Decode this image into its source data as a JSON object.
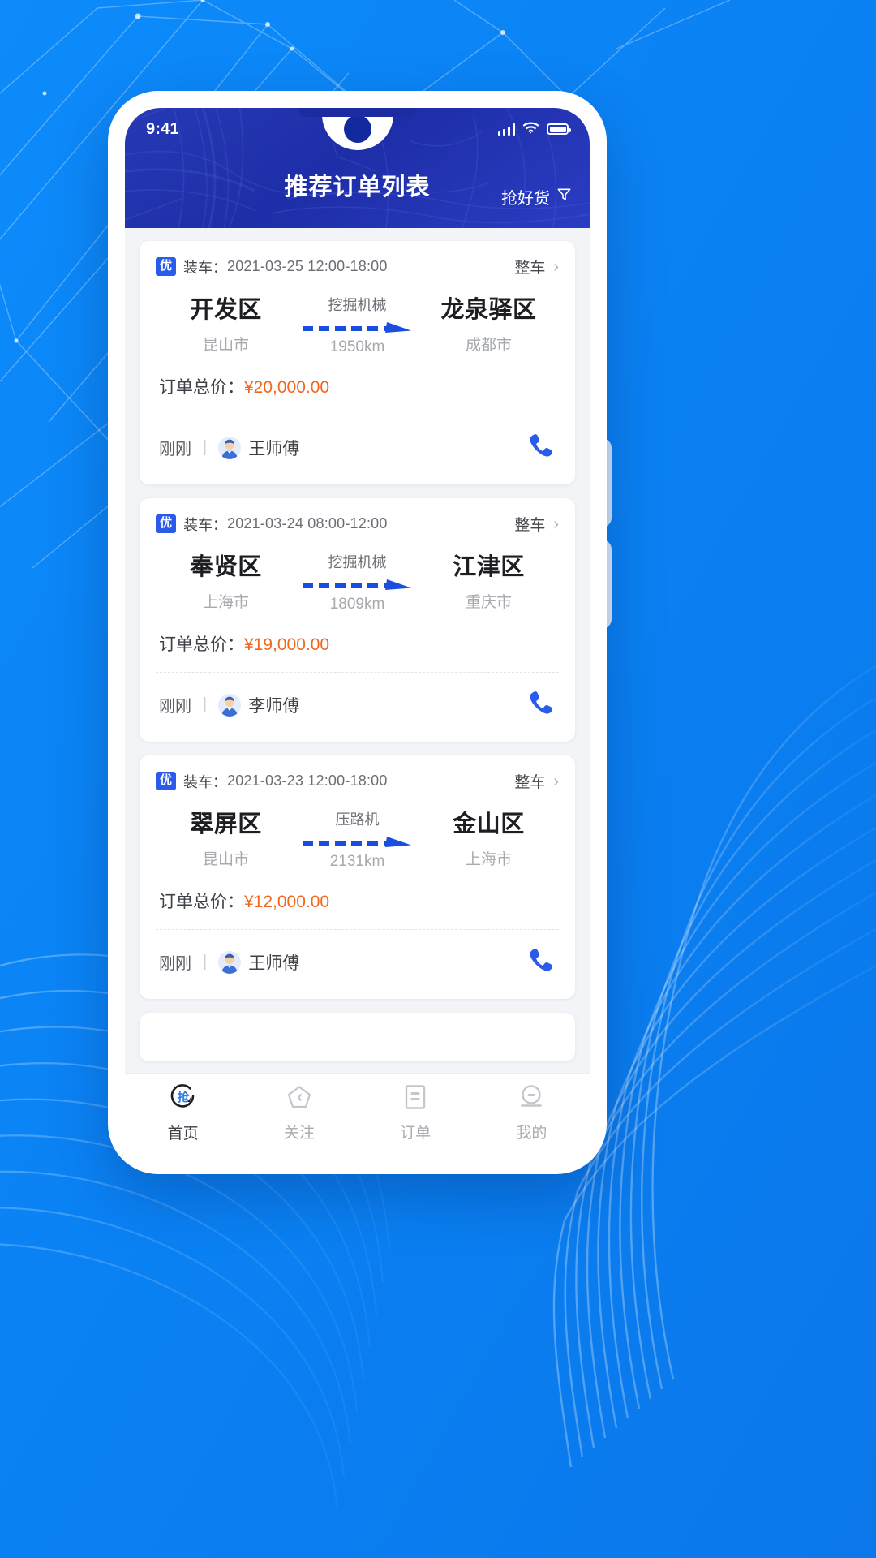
{
  "status_bar": {
    "time": "9:41",
    "signal_icon": "signal-bars-icon",
    "wifi_icon": "wifi-icon",
    "battery_icon": "battery-icon"
  },
  "header": {
    "title": "推荐订单列表",
    "action_label": "抢好货",
    "action_icon": "filter-funnel-icon"
  },
  "orders": [
    {
      "badge": "优",
      "load_label": "装车：",
      "load_time": "2021-03-25 12:00-18:00",
      "type_label": "整车",
      "chevron": "›",
      "from_district": "开发区",
      "from_city": "昆山市",
      "cargo": "挖掘机械",
      "distance": "1950km",
      "to_district": "龙泉驿区",
      "to_city": "成都市",
      "price_label": "订单总价：",
      "price_value": "¥20,000.00",
      "posted_time": "刚刚",
      "separator": "|",
      "driver": "王师傅",
      "call_icon": "phone-icon"
    },
    {
      "badge": "优",
      "load_label": "装车：",
      "load_time": "2021-03-24 08:00-12:00",
      "type_label": "整车",
      "chevron": "›",
      "from_district": "奉贤区",
      "from_city": "上海市",
      "cargo": "挖掘机械",
      "distance": "1809km",
      "to_district": "江津区",
      "to_city": "重庆市",
      "price_label": "订单总价：",
      "price_value": "¥19,000.00",
      "posted_time": "刚刚",
      "separator": "|",
      "driver": "李师傅",
      "call_icon": "phone-icon"
    },
    {
      "badge": "优",
      "load_label": "装车：",
      "load_time": "2021-03-23 12:00-18:00",
      "type_label": "整车",
      "chevron": "›",
      "from_district": "翠屏区",
      "from_city": "昆山市",
      "cargo": "压路机",
      "distance": "2131km",
      "to_district": "金山区",
      "to_city": "上海市",
      "price_label": "订单总价：",
      "price_value": "¥12,000.00",
      "posted_time": "刚刚",
      "separator": "|",
      "driver": "王师傅",
      "call_icon": "phone-icon"
    }
  ],
  "tabbar": {
    "items": [
      {
        "label": "首页",
        "icon": "grab-circle-icon",
        "active": true
      },
      {
        "label": "关注",
        "icon": "pentagon-home-icon",
        "active": false
      },
      {
        "label": "订单",
        "icon": "document-icon",
        "active": false
      },
      {
        "label": "我的",
        "icon": "user-circle-icon",
        "active": false
      }
    ]
  },
  "colors": {
    "page_background": "#0a84f5",
    "header_blue": "#1e2ea8",
    "badge_blue": "#2a5bea",
    "price_orange": "#f4661b",
    "arrow_blue": "#1a4ee0",
    "phone_blue": "#2a5bea",
    "card_background": "#ffffff",
    "list_background": "#f2f4f7"
  }
}
